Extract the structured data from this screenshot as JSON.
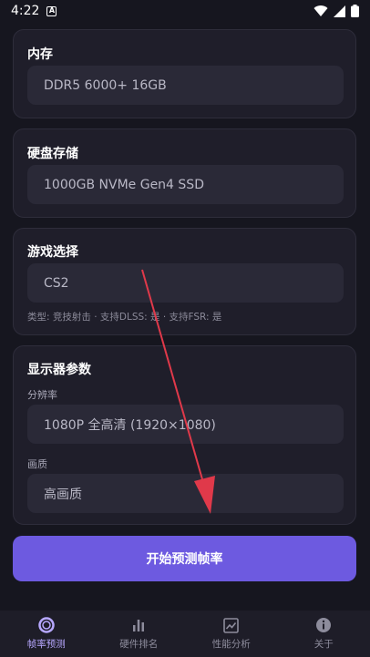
{
  "statusbar": {
    "time": "4:22",
    "badge": "A"
  },
  "memory": {
    "title": "内存",
    "value": "DDR5 6000+ 16GB"
  },
  "storage": {
    "title": "硬盘存储",
    "value": "1000GB NVMe Gen4 SSD"
  },
  "game": {
    "title": "游戏选择",
    "value": "CS2",
    "meta": "类型: 竞技射击 · 支持DLSS: 是 · 支持FSR: 是"
  },
  "display": {
    "title": "显示器参数",
    "resolution_label": "分辨率",
    "resolution_value": "1080P 全高清 (1920×1080)",
    "quality_label": "画质",
    "quality_value": "高画质"
  },
  "action": {
    "start_label": "开始预测帧率"
  },
  "nav": {
    "items": [
      {
        "label": "帧率预测",
        "icon": "target-icon",
        "active": true
      },
      {
        "label": "硬件排名",
        "icon": "bar-chart-icon",
        "active": false
      },
      {
        "label": "性能分析",
        "icon": "image-chart-icon",
        "active": false
      },
      {
        "label": "关于",
        "icon": "info-icon",
        "active": false
      }
    ]
  },
  "colors": {
    "accent": "#6d5ae0",
    "nav_active": "#b7a8ff",
    "arrow": "#e0394a"
  }
}
